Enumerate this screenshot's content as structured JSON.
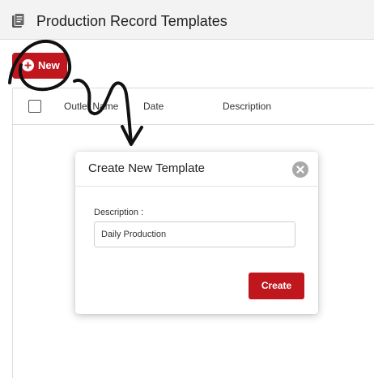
{
  "header": {
    "title": "Production Record Templates",
    "icon": "document-stack-icon"
  },
  "toolbar": {
    "new_label": "New",
    "new_icon": "plus-circle-icon"
  },
  "table": {
    "columns": [
      "Outlet Name",
      "Date",
      "Description"
    ]
  },
  "modal": {
    "title": "Create New Template",
    "close_icon": "close-icon",
    "description_label": "Description :",
    "description_value": "Daily Production",
    "create_label": "Create"
  },
  "colors": {
    "accent": "#c0171e",
    "header_bg": "#f3f3f3",
    "annotation": "#111111"
  }
}
